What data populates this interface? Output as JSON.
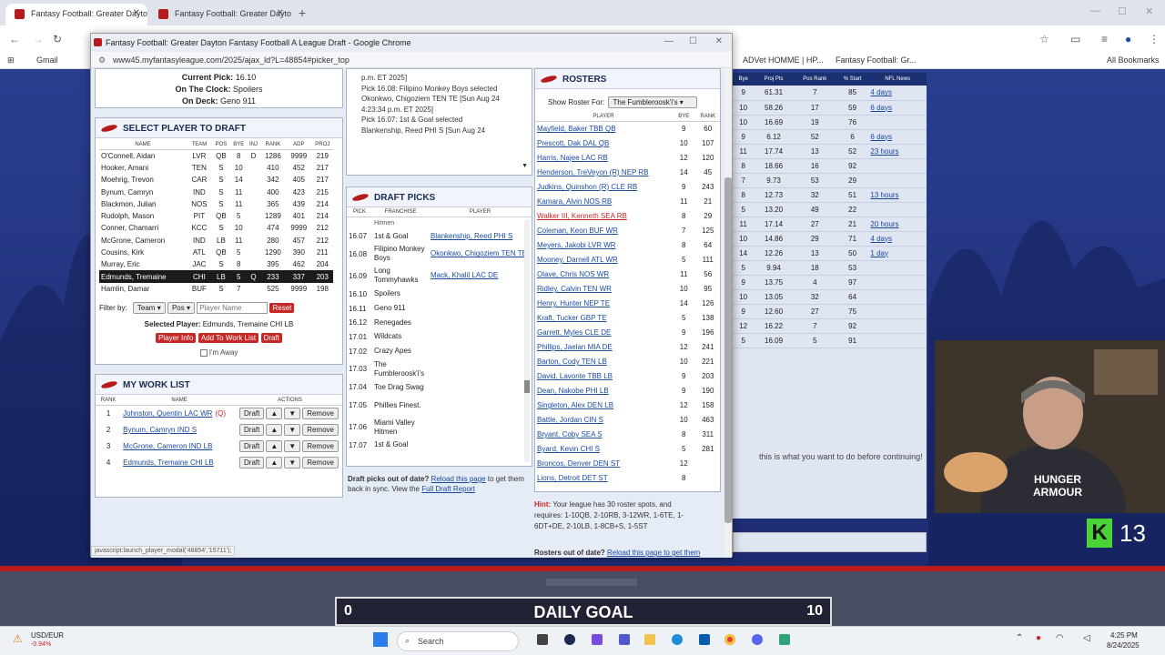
{
  "browser": {
    "tabs": [
      {
        "title": "Fantasy Football: Greater Dayton"
      },
      {
        "title": "Fantasy Football: Greater Dayton"
      }
    ],
    "bookmarks": [
      "Gmail",
      "ADVet HOMME | HP...",
      "Fantasy Football: Gr...",
      "All Bookmarks"
    ]
  },
  "popup": {
    "title": "Fantasy Football: Greater Dayton Fantasy Football A League Draft - Google Chrome",
    "url": "www45.myfantasyleague.com/2025/ajax_ld?L=48854#picker_top",
    "status": {
      "current_pick_label": "Current Pick:",
      "current_pick": "16.10",
      "on_clock_label": "On The Clock:",
      "on_clock": "Spoilers",
      "on_deck_label": "On Deck:",
      "on_deck": "Geno 911"
    },
    "recent_picks": [
      "p.m. ET 2025]",
      "Pick 16.08: Filipino Monkey Boys selected",
      "Okonkwo, Chigoziem TEN TE [Sun Aug 24",
      "4:23:34 p.m. ET 2025]",
      "Pick 16.07: 1st & Goal selected",
      "Blankenship, Reed PHI S [Sun Aug 24"
    ],
    "select_player": {
      "heading": "SELECT PLAYER TO DRAFT",
      "columns": [
        "Name",
        "Team",
        "Pos",
        "Bye",
        "Inj",
        "Rank",
        "ADP",
        "Proj"
      ],
      "rows": [
        [
          "O'Connell, Aidan",
          "LVR",
          "QB",
          "8",
          "D",
          "1286",
          "9999",
          "219"
        ],
        [
          "Hooker, Amani",
          "TEN",
          "S",
          "10",
          "",
          "410",
          "452",
          "217"
        ],
        [
          "Moehrig, Trevon",
          "CAR",
          "S",
          "14",
          "",
          "342",
          "405",
          "217"
        ],
        [
          "Bynum, Camryn",
          "IND",
          "S",
          "11",
          "",
          "400",
          "423",
          "215"
        ],
        [
          "Blackmon, Julian",
          "NOS",
          "S",
          "11",
          "",
          "365",
          "439",
          "214"
        ],
        [
          "Rudolph, Mason",
          "PIT",
          "QB",
          "5",
          "",
          "1289",
          "401",
          "214"
        ],
        [
          "Conner, Chamarri",
          "KCC",
          "S",
          "10",
          "",
          "474",
          "9999",
          "212"
        ],
        [
          "McGrone, Cameron",
          "IND",
          "LB",
          "11",
          "",
          "280",
          "457",
          "212"
        ],
        [
          "Cousins, Kirk",
          "ATL",
          "QB",
          "5",
          "",
          "1290",
          "390",
          "211"
        ],
        [
          "Murray, Eric",
          "JAC",
          "S",
          "8",
          "",
          "395",
          "462",
          "204"
        ],
        [
          "Edmunds, Tremaine",
          "CHI",
          "LB",
          "5",
          "Q",
          "233",
          "337",
          "203"
        ],
        [
          "Hamlin, Damar",
          "BUF",
          "S",
          "7",
          "",
          "525",
          "9999",
          "198"
        ]
      ],
      "filter_label": "Filter by:",
      "team_filter": "Team",
      "pos_filter": "Pos",
      "name_placeholder": "Player Name",
      "reset": "Reset",
      "selected_label": "Selected Player:",
      "selected_value": "Edmunds, Tremaine CHI LB",
      "btn_info": "Player Info",
      "btn_worklist": "Add To Work List",
      "btn_draft": "Draft",
      "away_label": "I'm Away"
    },
    "work_list": {
      "heading": "MY WORK LIST",
      "columns": [
        "Rank",
        "Name",
        "Actions"
      ],
      "items": [
        {
          "rank": "1",
          "name": "Johnston, Quentin LAC WR",
          "flag": "(Q)"
        },
        {
          "rank": "2",
          "name": "Bynum, Camryn IND S",
          "flag": ""
        },
        {
          "rank": "3",
          "name": "McGrone, Cameron IND LB",
          "flag": ""
        },
        {
          "rank": "4",
          "name": "Edmunds, Tremaine CHI LB",
          "flag": ""
        }
      ],
      "draft_btn": "Draft",
      "up": "▲",
      "down": "▼",
      "remove": "Remove"
    },
    "draft_picks": {
      "heading": "DRAFT PICKS",
      "columns": [
        "Pick",
        "Franchise",
        "Player"
      ],
      "top_fragment": "Hitmen",
      "rows": [
        {
          "pick": "16.07",
          "franchise": "1st & Goal",
          "player": "Blankenship, Reed PHI S"
        },
        {
          "pick": "16.08",
          "franchise": "Filipino Monkey Boys",
          "player": "Okonkwo, Chigoziem TEN TE"
        },
        {
          "pick": "16.09",
          "franchise": "Long Tommyhawks",
          "player": "Mack, Khalil LAC DE"
        },
        {
          "pick": "16.10",
          "franchise": "Spoilers",
          "player": ""
        },
        {
          "pick": "16.11",
          "franchise": "Geno 911",
          "player": ""
        },
        {
          "pick": "16.12",
          "franchise": "Renegades",
          "player": ""
        },
        {
          "pick": "17.01",
          "franchise": "Wildcats",
          "player": ""
        },
        {
          "pick": "17.02",
          "franchise": "Crazy Apes",
          "player": ""
        },
        {
          "pick": "17.03",
          "franchise": "The Fumbleroosk'i's",
          "player": ""
        },
        {
          "pick": "17.04",
          "franchise": "Toe Drag Swag",
          "player": ""
        },
        {
          "pick": "17.05",
          "franchise": "Phillies Finest.",
          "player": ""
        },
        {
          "pick": "17.06",
          "franchise": "Miami Valley Hitmen",
          "player": ""
        },
        {
          "pick": "17.07",
          "franchise": "1st & Goal",
          "player": ""
        }
      ],
      "note_pre": "Draft picks out of date?",
      "note_link1": "Reload this page",
      "note_mid": "to get them back in sync. View the",
      "note_link2": "Full Draft Report"
    },
    "rosters": {
      "heading": "ROSTERS",
      "show_label": "Show Roster For:",
      "show_value": "The Fumbleroosk'i's",
      "columns": [
        "Player",
        "Bye",
        "Rank"
      ],
      "rows": [
        [
          "Mayfield, Baker TBB QB",
          "9",
          "60"
        ],
        [
          "Prescott, Dak DAL QB",
          "10",
          "107"
        ],
        [
          "Harris, Najee LAC RB",
          "12",
          "120"
        ],
        [
          "Henderson, TreVeyon (R) NEP RB",
          "14",
          "45"
        ],
        [
          "Judkins, Quinshon (R) CLE RB",
          "9",
          "243"
        ],
        [
          "Kamara, Alvin NOS RB",
          "11",
          "21"
        ],
        [
          "Walker III, Kenneth SEA RB",
          "8",
          "29"
        ],
        [
          "Coleman, Keon BUF WR",
          "7",
          "125"
        ],
        [
          "Meyers, Jakobi LVR WR",
          "8",
          "64"
        ],
        [
          "Mooney, Darnell ATL WR",
          "5",
          "111"
        ],
        [
          "Olave, Chris NOS WR",
          "11",
          "56"
        ],
        [
          "Ridley, Calvin TEN WR",
          "10",
          "95"
        ],
        [
          "Henry, Hunter NEP TE",
          "14",
          "126"
        ],
        [
          "Kraft, Tucker GBP TE",
          "5",
          "138"
        ],
        [
          "Garrett, Myles CLE DE",
          "9",
          "196"
        ],
        [
          "Phillips, Jaelan MIA DE",
          "12",
          "241"
        ],
        [
          "Barton, Cody TEN LB",
          "10",
          "221"
        ],
        [
          "David, Lavonte TBB LB",
          "9",
          "203"
        ],
        [
          "Dean, Nakobe PHI LB",
          "9",
          "190"
        ],
        [
          "Singleton, Alex DEN LB",
          "12",
          "158"
        ],
        [
          "Battle, Jordan CIN S",
          "10",
          "463"
        ],
        [
          "Bryant, Coby SEA S",
          "8",
          "311"
        ],
        [
          "Byard, Kevin CHI S",
          "5",
          "281"
        ],
        [
          "Broncos, Denver DEN ST",
          "12",
          ""
        ],
        [
          "Lions, Detroit DET ST",
          "8",
          ""
        ]
      ],
      "hint_label": "Hint:",
      "hint_text": "Your league has 30 roster spots, and requires: 1-10QB, 2-10RB, 3-12WR, 1-6TE, 1-6DT+DE, 2-10LB, 1-8CB+S, 1-5ST",
      "foot_pre": "Rosters out of date?",
      "foot_link": "Reload this page to get them"
    },
    "status_bar": "javascript:launch_player_modal('48854','15711');"
  },
  "bg_page": {
    "columns": [
      "Bye",
      "Proj Pts",
      "Pos Rank",
      "% Start",
      "NFL News"
    ],
    "rows": [
      [
        "9",
        "61.31",
        "7",
        "85",
        "4 days"
      ],
      [
        "10",
        "58.26",
        "17",
        "59",
        "6 days"
      ],
      [
        "10",
        "16.69",
        "19",
        "76",
        ""
      ],
      [
        "9",
        "6.12",
        "52",
        "6",
        "6 days"
      ],
      [
        "11",
        "17.74",
        "13",
        "52",
        "23 hours"
      ],
      [
        "8",
        "18.66",
        "16",
        "92",
        ""
      ],
      [
        "7",
        "9.73",
        "53",
        "29",
        ""
      ],
      [
        "8",
        "12.73",
        "32",
        "51",
        "13 hours"
      ],
      [
        "5",
        "13.20",
        "49",
        "22",
        ""
      ],
      [
        "11",
        "17.14",
        "27",
        "21",
        "20 hours"
      ],
      [
        "10",
        "14.86",
        "29",
        "71",
        "4 days"
      ],
      [
        "14",
        "12.26",
        "13",
        "50",
        "1 day"
      ],
      [
        "5",
        "9.94",
        "18",
        "53",
        ""
      ],
      [
        "9",
        "13.75",
        "4",
        "97",
        ""
      ],
      [
        "10",
        "13.05",
        "32",
        "64",
        ""
      ],
      [
        "9",
        "12.60",
        "27",
        "75",
        ""
      ],
      [
        "12",
        "16.22",
        "7",
        "92",
        ""
      ],
      [
        "5",
        "16.09",
        "5",
        "91",
        ""
      ]
    ],
    "message": "this is what you want to do before continuing!"
  },
  "overlay": {
    "goal_label": "DAILY GOAL",
    "goal_current": "0",
    "goal_target": "10",
    "badge_letter": "K",
    "badge_count": "13",
    "shirt_text": "HUNGER ARMOUR"
  },
  "taskbar": {
    "ticker": "USD/EUR",
    "ticker_change": "-0.94%",
    "search": "Search",
    "time": "4:25 PM",
    "date": "8/24/2025"
  }
}
